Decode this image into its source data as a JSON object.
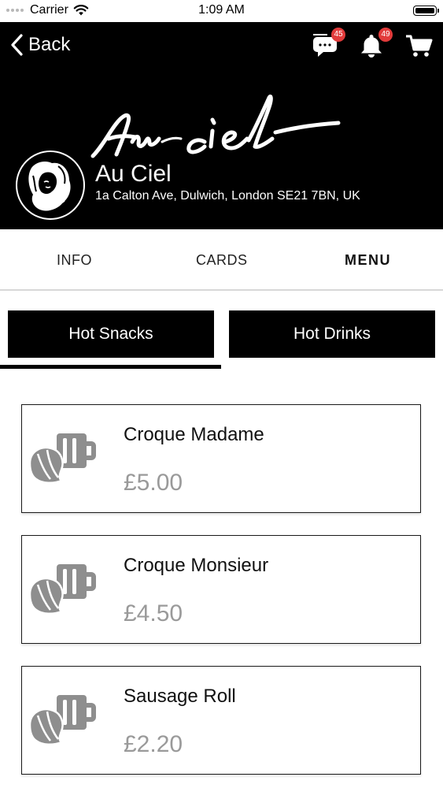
{
  "status_bar": {
    "carrier": "Carrier",
    "time": "1:09 AM",
    "icons": [
      "signal-dots-icon",
      "wifi-icon",
      "battery-icon"
    ]
  },
  "header": {
    "back_label": "Back",
    "logo_text": "Au ciel",
    "chat_badge": "45",
    "notifications_badge": "49",
    "icons": [
      "chevron-left-icon",
      "chat-icon",
      "bell-icon",
      "cart-icon"
    ],
    "restaurant_name": "Au Ciel",
    "restaurant_address": "1a Calton Ave, Dulwich, London SE21 7BN, UK"
  },
  "main_tabs": [
    {
      "label": "INFO",
      "active": false
    },
    {
      "label": "CARDS",
      "active": false
    },
    {
      "label": "MENU",
      "active": true
    }
  ],
  "categories": [
    {
      "label": "Hot Snacks",
      "selected": true
    },
    {
      "label": "Hot Drinks",
      "selected": false
    }
  ],
  "menu_items": [
    {
      "name": "Croque Madame",
      "price": "£5.00",
      "icon": "croissant-coffee-icon"
    },
    {
      "name": "Croque Monsieur",
      "price": "£4.50",
      "icon": "croissant-coffee-icon"
    },
    {
      "name": "Sausage Roll",
      "price": "£2.20",
      "icon": "croissant-coffee-icon"
    }
  ],
  "colors": {
    "header_bg": "#000000",
    "badge": "#e23b3b",
    "price": "#9a9a9a",
    "icon_gray": "#8e8e8e"
  }
}
